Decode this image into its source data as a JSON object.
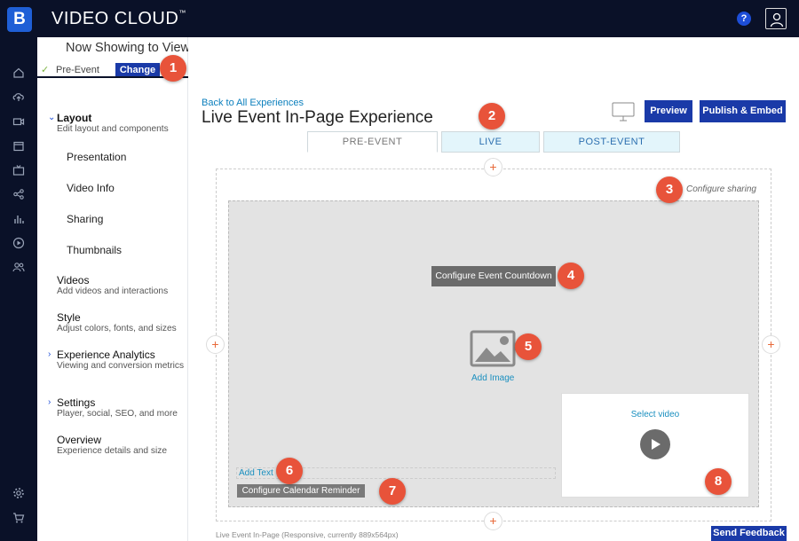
{
  "app": {
    "title": "VIDEO CLOUD",
    "trademark": "™",
    "logo_letter": "B"
  },
  "header": {
    "help_label": "?"
  },
  "rail": {
    "icons": [
      "home-icon",
      "upload-icon",
      "media-icon",
      "live-icon",
      "tv-icon",
      "social-icon",
      "analytics-icon",
      "play-icon",
      "users-icon",
      "settings-icon",
      "cart-icon"
    ]
  },
  "now_showing": {
    "title": "Now Showing to Viewers:",
    "status": "Pre-Event",
    "change_label": "Change"
  },
  "nav": {
    "layout": {
      "title": "Layout",
      "subtitle": "Edit layout and components",
      "children": [
        "Presentation",
        "Video Info",
        "Sharing",
        "Thumbnails"
      ]
    },
    "videos": {
      "title": "Videos",
      "subtitle": "Add videos and interactions"
    },
    "style": {
      "title": "Style",
      "subtitle": "Adjust colors, fonts, and sizes"
    },
    "analytics": {
      "title": "Experience Analytics",
      "subtitle": "Viewing and conversion metrics"
    },
    "settings": {
      "title": "Settings",
      "subtitle": "Player, social, SEO, and more"
    },
    "overview": {
      "title": "Overview",
      "subtitle": "Experience details and size"
    }
  },
  "main": {
    "back_link": "Back to All Experiences",
    "title": "Live Event In-Page Experience",
    "preview_label": "Preview",
    "publish_label": "Publish & Embed",
    "tabs": [
      "PRE-EVENT",
      "LIVE",
      "POST-EVENT"
    ],
    "plus": "+",
    "configure_sharing": "Configure sharing",
    "countdown_label": "Configure Event Countdown",
    "add_image": "Add Image",
    "select_video": "Select video",
    "add_text": "Add Text",
    "calendar_label": "Configure Calendar Reminder",
    "footer_note": "Live Event In-Page (Responsive, currently 889x564px)",
    "feedback_label": "Send Feedback"
  },
  "callouts": [
    "1",
    "2",
    "3",
    "4",
    "5",
    "6",
    "7",
    "8"
  ],
  "colors": {
    "topbar": "#0a1128",
    "primary_button": "#1a3aa8",
    "callout": "#e8533a",
    "link": "#1a8fbf"
  }
}
